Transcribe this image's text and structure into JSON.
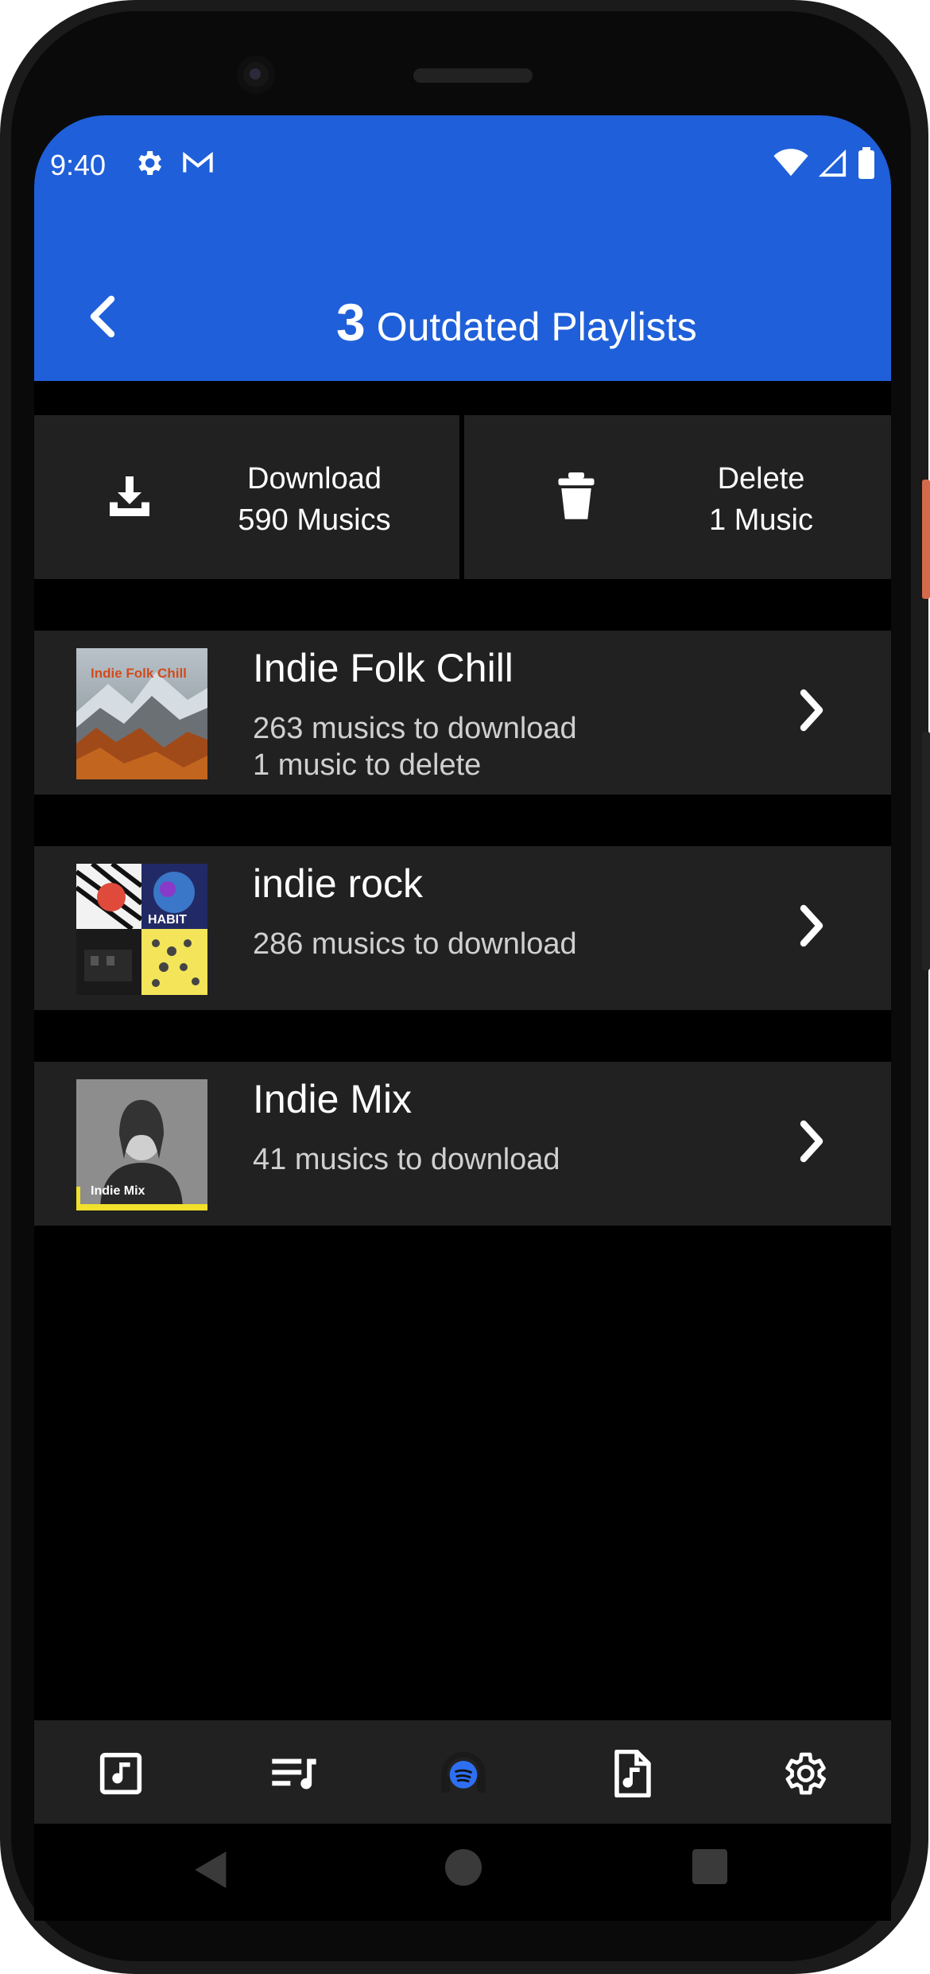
{
  "status_bar": {
    "time": "9:40"
  },
  "header": {
    "count": "3",
    "title": "Outdated Playlists"
  },
  "actions": {
    "download": {
      "line1": "Download",
      "line2": "590 Musics"
    },
    "delete": {
      "line1": "Delete",
      "line2": "1 Music"
    }
  },
  "playlists": [
    {
      "name": "Indie Folk Chill",
      "line1": "263 musics to download",
      "line2": "1 music to delete",
      "cover_text": "Indie Folk Chill"
    },
    {
      "name": "indie rock",
      "line1": "286 musics to download",
      "line2": "",
      "cover_text": "HABIT"
    },
    {
      "name": "Indie Mix",
      "line1": "41 musics to download",
      "line2": "",
      "cover_text": "Indie Mix"
    }
  ],
  "colors": {
    "appbar": "#1f5fd9",
    "card": "#212121",
    "accent": "#2e6ff2",
    "mix_yellow": "#f2e12b"
  },
  "bottom_nav_icons": [
    "music-note-icon",
    "playlist-icon",
    "headphones-logo-icon",
    "music-file-icon",
    "gear-icon"
  ]
}
